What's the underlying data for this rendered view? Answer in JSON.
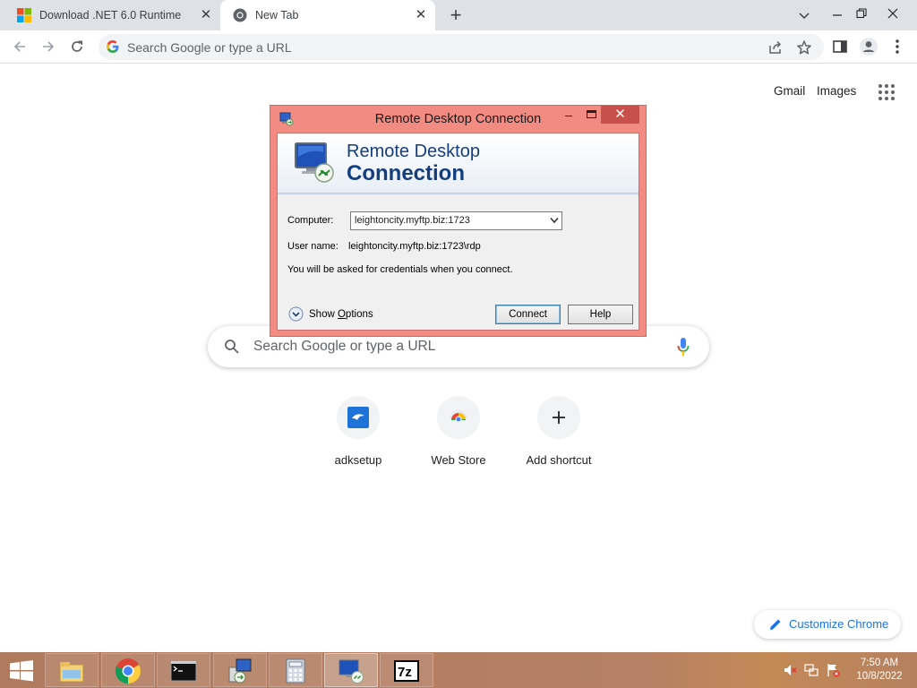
{
  "browser": {
    "tabs": [
      {
        "title": "Download .NET 6.0 Runtime",
        "active": false,
        "favicon": "windows-logo-icon"
      },
      {
        "title": "New Tab",
        "active": true,
        "favicon": "chrome-icon"
      }
    ],
    "omnibox_placeholder": "Search Google or type a URL"
  },
  "ntp": {
    "links": {
      "gmail": "Gmail",
      "images": "Images"
    },
    "search_placeholder": "Search Google or type a URL",
    "shortcuts": [
      {
        "label": "adksetup",
        "icon": "adksetup-icon"
      },
      {
        "label": "Web Store",
        "icon": "chrome-web-store-icon"
      },
      {
        "label": "Add shortcut",
        "icon": "plus-icon"
      }
    ],
    "customize_label": "Customize Chrome"
  },
  "rdp_dialog": {
    "window_title": "Remote Desktop Connection",
    "banner_line1": "Remote Desktop",
    "banner_line2": "Connection",
    "computer_label": "Computer:",
    "computer_value": "leightoncity.myftp.biz:1723",
    "username_label": "User name:",
    "username_value": "leightoncity.myftp.biz:1723\\rdp",
    "info_text": "You will be asked for credentials when you connect.",
    "show_options_label": "Show Options",
    "show_options_mnemonic": "O",
    "connect_label": "Connect",
    "help_label": "Help",
    "title_bar_color": "#f28b82"
  },
  "taskbar": {
    "items": [
      "file-explorer-icon",
      "chrome-icon",
      "command-prompt-icon",
      "remote-desktop-setup-icon",
      "calculator-icon",
      "remote-desktop-connection-icon",
      "7zip-icon"
    ],
    "active_item": "remote-desktop-connection-icon",
    "time": "7:50 AM",
    "date": "10/8/2022"
  }
}
